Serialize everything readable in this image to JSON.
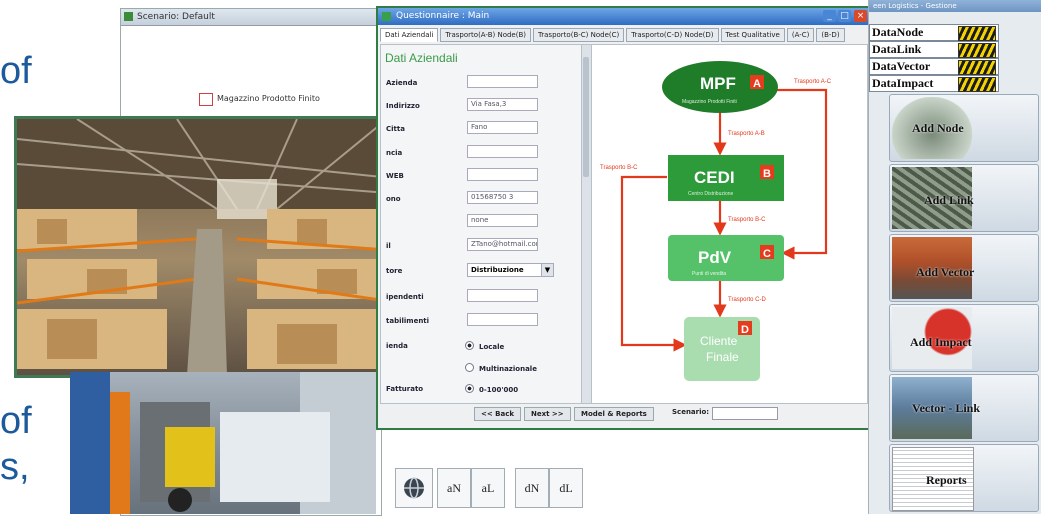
{
  "slide": {
    "fragment_top": "of",
    "fragment_mid": "of",
    "fragment_bottom": "s,"
  },
  "scenario_window": {
    "title": "Scenario: Default",
    "node_label": "Magazzino Prodotto Finito"
  },
  "questionnaire": {
    "title": "Questionnaire : Main",
    "tabs": [
      "Dati Aziendali",
      "Trasporto(A-B) Node(B)",
      "Trasporto(B-C) Node(C)",
      "Trasporto(C-D) Node(D)",
      "Test Qualitative",
      "(A-C)",
      "(B-D)"
    ],
    "form_heading": "Dati Aziendali",
    "fields": [
      {
        "label": "Azienda",
        "value": ""
      },
      {
        "label": "Indirizzo",
        "value": "Via Fasa,3"
      },
      {
        "label": "Citta",
        "value": "Fano"
      },
      {
        "label": "ncia",
        "value": ""
      },
      {
        "label": "WEB",
        "value": ""
      },
      {
        "label": "ono",
        "value": "01568750 3"
      },
      {
        "label": "",
        "value": "none"
      },
      {
        "label": "il",
        "value": "ZTano@hotmail.com"
      }
    ],
    "sector_label": "tore",
    "sector_value": "Distribuzione",
    "field_dipendenti": "ipendenti",
    "field_stabilimenti": "tabilimenti",
    "radio_group_label": "ienda",
    "radio_locale": "Locale",
    "radio_multinazionale": "Multinazionale",
    "fatturato_label": "Fatturato",
    "fatturato_value": "0-100'000",
    "back_button": "<< Back",
    "next_button": "Next >>",
    "model_button": "Model & Reports",
    "scenario_label": "Scenario:",
    "scenario_value": ""
  },
  "diagram": {
    "nodes": {
      "mpf": {
        "title": "MPF",
        "badge": "A",
        "subtitle": "Magazzino Prodotti Finiti"
      },
      "cedi": {
        "title": "CEDI",
        "badge": "B",
        "subtitle": "Centro Distribuzione"
      },
      "pdv": {
        "title": "PdV",
        "badge": "C",
        "subtitle": "Punti di vendita"
      },
      "cliente": {
        "title": "Cliente Finale",
        "line1": "Cliente",
        "line2": "Finale",
        "badge": "D"
      }
    },
    "edges": {
      "ab": "Trasporto A-B",
      "ac": "Trasporto A-C",
      "bc_top": "Trasporto B-C",
      "bc_left": "Trasporto B-C",
      "cd": "Trasporto C-D"
    },
    "colors": {
      "node_dark": "#1f7d2a",
      "node_mid": "#2e9b3a",
      "node_light": "#55c26a",
      "node_pale": "#a9ddb0",
      "arrow": "#e2391c",
      "badge": "#e63c1e"
    }
  },
  "right_panel": {
    "title": "een Logistics - Gestione",
    "data_items": [
      "DataNode",
      "DataLink",
      "DataVector",
      "DataImpact"
    ],
    "buttons": [
      "Add Node",
      "Add Link",
      "Add Vector",
      "Add Impact",
      "Vector - Link",
      "Reports"
    ]
  },
  "toolbar": {
    "buttons": [
      "aN",
      "aL",
      "dN",
      "dL"
    ]
  }
}
